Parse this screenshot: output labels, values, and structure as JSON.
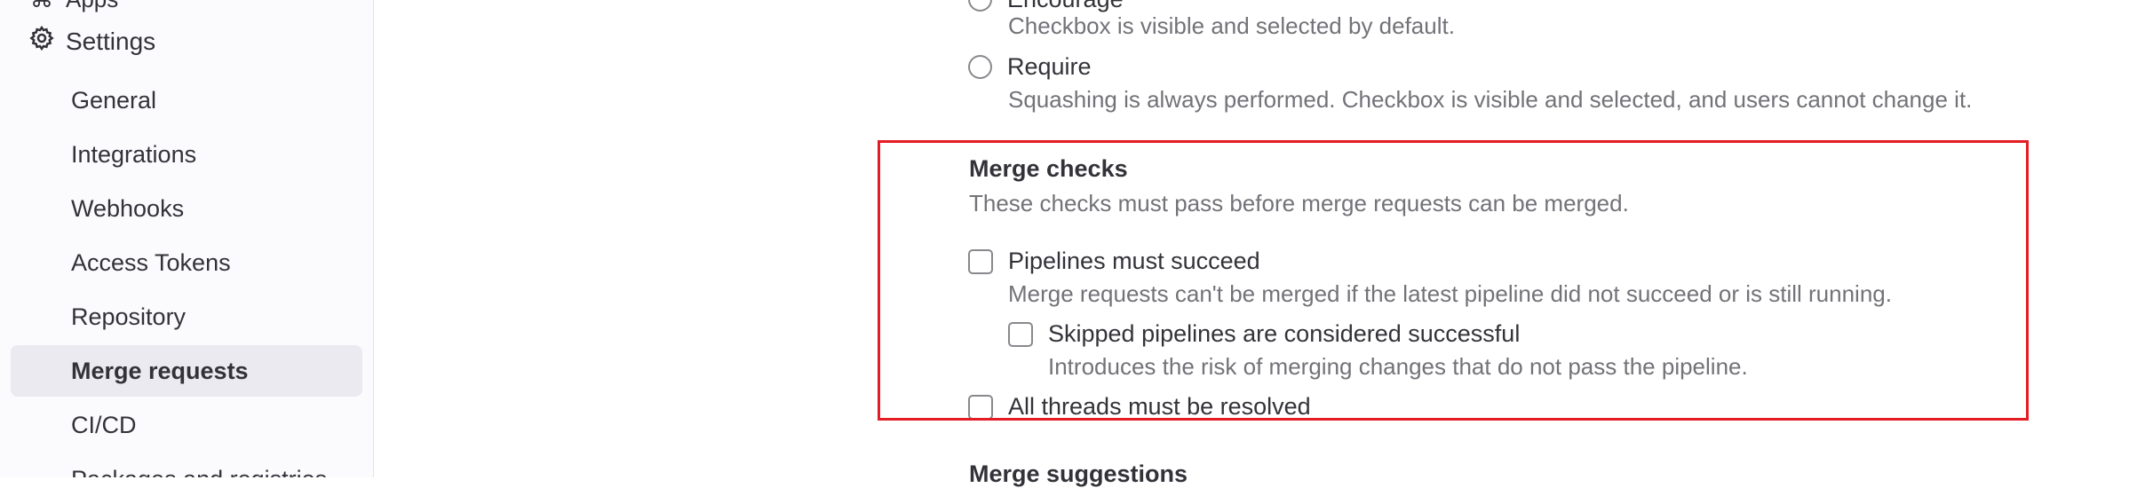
{
  "sidebar": {
    "top_stub_label": "Apps",
    "settings_label": "Settings",
    "items": [
      {
        "label": "General",
        "active": false
      },
      {
        "label": "Integrations",
        "active": false
      },
      {
        "label": "Webhooks",
        "active": false
      },
      {
        "label": "Access Tokens",
        "active": false
      },
      {
        "label": "Repository",
        "active": false
      },
      {
        "label": "Merge requests",
        "active": true
      },
      {
        "label": "CI/CD",
        "active": false
      },
      {
        "label": "Packages and registries",
        "active": false
      }
    ]
  },
  "squash": {
    "encourage": {
      "label": "Encourage",
      "help": "Checkbox is visible and selected by default.",
      "selected": false
    },
    "require": {
      "label": "Require",
      "help": "Squashing is always performed. Checkbox is visible and selected, and users cannot change it.",
      "selected": false
    }
  },
  "merge_checks": {
    "heading": "Merge checks",
    "description": "These checks must pass before merge requests can be merged.",
    "pipelines": {
      "label": "Pipelines must succeed",
      "help": "Merge requests can't be merged if the latest pipeline did not succeed or is still running.",
      "checked": false
    },
    "skipped": {
      "label": "Skipped pipelines are considered successful",
      "help": "Introduces the risk of merging changes that do not pass the pipeline.",
      "checked": false
    },
    "threads": {
      "label": "All threads must be resolved",
      "checked": false
    }
  },
  "merge_suggestions": {
    "heading": "Merge suggestions"
  },
  "colors": {
    "highlight_border": "#e41c24",
    "active_item_bg": "#ebeaf0"
  }
}
